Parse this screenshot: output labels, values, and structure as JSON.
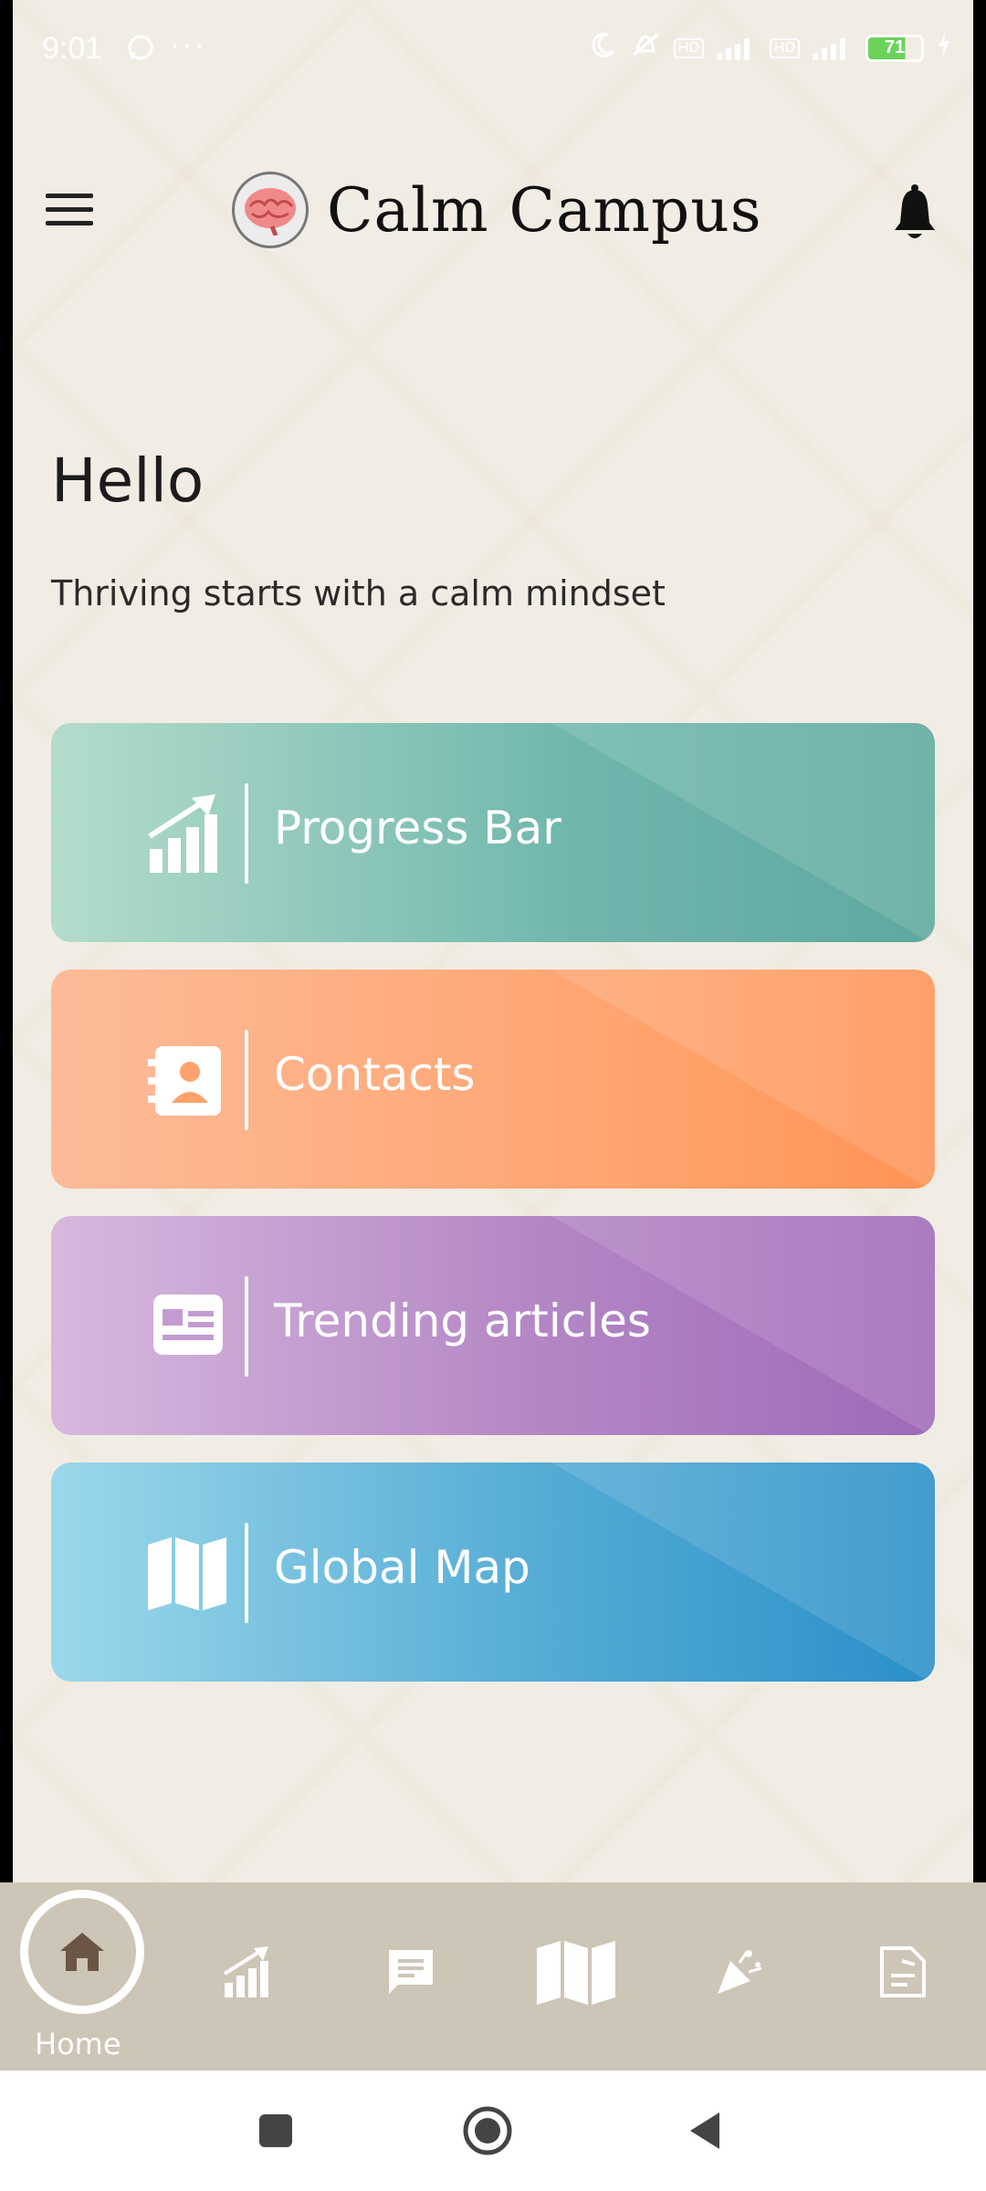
{
  "status_bar": {
    "time": "9:01",
    "battery": "71"
  },
  "header": {
    "app_title": "Calm Campus",
    "menu_icon": "hamburger-menu-icon",
    "logo_icon": "brain-logo-icon",
    "notification_icon": "bell-icon"
  },
  "greeting": {
    "title": "Hello",
    "subtitle": "Thriving starts with a calm mindset"
  },
  "cards": [
    {
      "label": "Progress Bar",
      "icon": "chart-growth-icon",
      "color_start": "#b3dccb",
      "color_end": "#5ea89f"
    },
    {
      "label": "Contacts",
      "icon": "contacts-book-icon",
      "color_start": "#fdbb99",
      "color_end": "#ff9356"
    },
    {
      "label": "Trending articles",
      "icon": "newspaper-icon",
      "color_start": "#d7b8de",
      "color_end": "#9f69b8"
    },
    {
      "label": "Global Map",
      "icon": "map-icon",
      "color_start": "#9bd8ea",
      "color_end": "#2a8fc9"
    }
  ],
  "bottom_nav": {
    "active_label": "Home",
    "items": [
      "home-icon",
      "chart-growth-icon",
      "chat-icon",
      "map-icon",
      "celebration-icon",
      "document-icon"
    ],
    "background": "#cdc5b6"
  },
  "system_nav": {
    "items": [
      "recents-square-icon",
      "home-circle-icon",
      "back-triangle-icon"
    ]
  }
}
